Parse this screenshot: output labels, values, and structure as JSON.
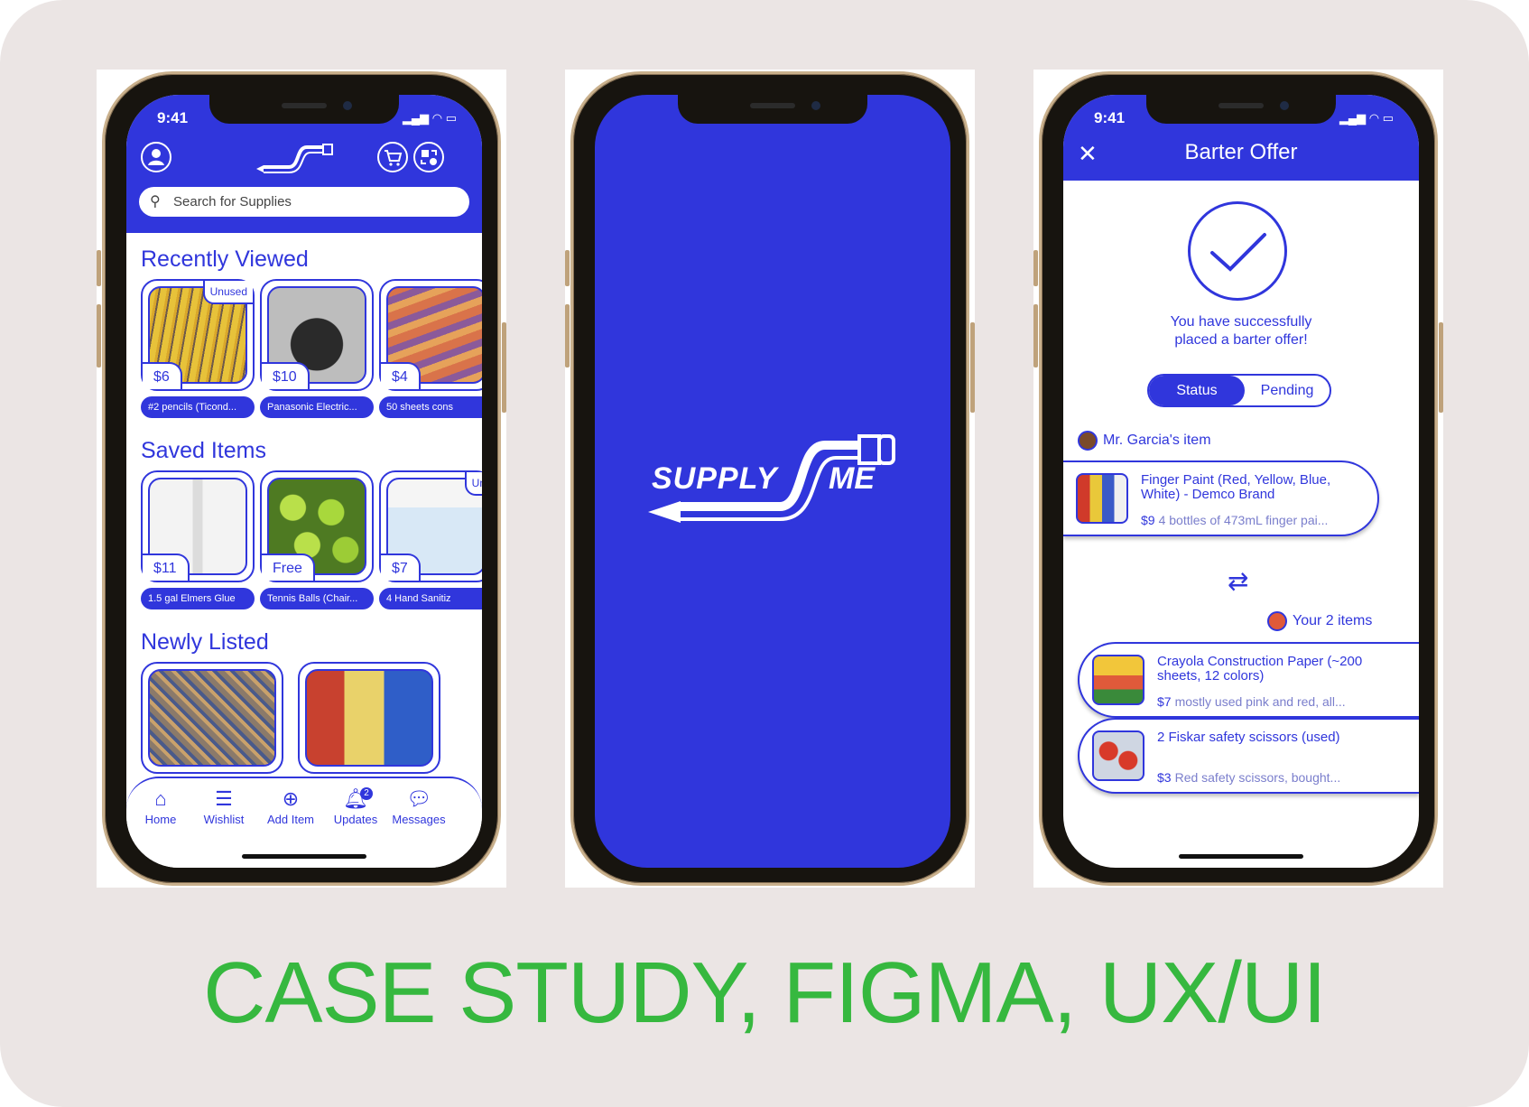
{
  "caption": "CASE STUDY, FIGMA, UX/UI",
  "colors": {
    "brand_blue": "#3036dc",
    "caption_green": "#36b83f",
    "background": "#ebe5e4"
  },
  "phone1": {
    "status_time": "9:41",
    "search_placeholder": "Search for Supplies",
    "sections": {
      "recently_viewed": "Recently Viewed",
      "saved_items": "Saved Items",
      "newly_listed": "Newly Listed"
    },
    "recently_viewed": [
      {
        "price": "$6",
        "tag": "Unused",
        "label": "#2 pencils (Ticond..."
      },
      {
        "price": "$10",
        "tag": "",
        "label": "Panasonic Electric..."
      },
      {
        "price": "$4",
        "tag": "",
        "label": "50 sheets cons"
      }
    ],
    "saved_items": [
      {
        "price": "$11",
        "tag": "",
        "label": "1.5 gal Elmers Glue"
      },
      {
        "price": "Free",
        "tag": "",
        "label": "Tennis Balls (Chair..."
      },
      {
        "price": "$7",
        "tag": "Un",
        "label": "4 Hand Sanitiz"
      }
    ],
    "tabs": [
      {
        "label": "Home",
        "icon": "home-icon"
      },
      {
        "label": "Wishlist",
        "icon": "list-icon"
      },
      {
        "label": "Add Item",
        "icon": "plus-circle-icon"
      },
      {
        "label": "Updates",
        "icon": "bell-icon",
        "badge": "2"
      },
      {
        "label": "Messages",
        "icon": "chat-icon"
      }
    ]
  },
  "phone2": {
    "logo_left": "SUPPLY",
    "logo_right": "ME"
  },
  "phone3": {
    "status_time": "9:41",
    "title": "Barter Offer",
    "success_line1": "You have successfully",
    "success_line2": "placed a barter offer!",
    "toggle_on": "Status",
    "toggle_off": "Pending",
    "their_owner": "Mr. Garcia's item",
    "their_item": {
      "name": "Finger Paint (Red, Yellow, Blue, White) - Demco Brand",
      "price": "$9",
      "desc": "4 bottles of 473mL finger pai..."
    },
    "your_owner": "Your 2 items",
    "your_items": [
      {
        "name": "Crayola Construction Paper (~200 sheets, 12 colors)",
        "price": "$7",
        "desc": "mostly used pink and red, all..."
      },
      {
        "name": "2 Fiskar safety scissors (used)",
        "price": "$3",
        "desc": "Red safety scissors, bought..."
      }
    ]
  }
}
